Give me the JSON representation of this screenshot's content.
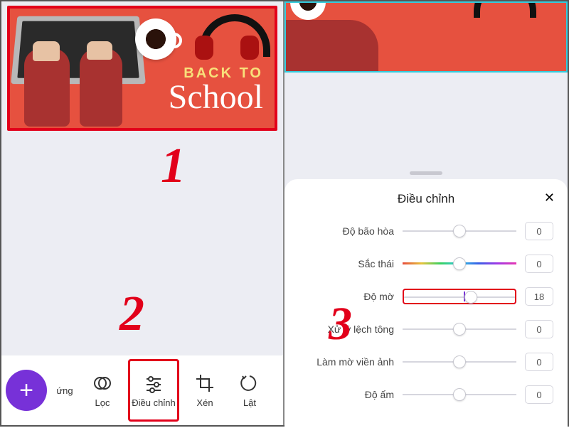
{
  "left": {
    "banner": {
      "line1": "BACK TO",
      "line2": "School"
    },
    "toolbar": {
      "fab": "+",
      "items": [
        {
          "label": "ứng",
          "icon": "sparkle-icon"
        },
        {
          "label": "Lọc",
          "icon": "overlap-circles-icon"
        },
        {
          "label": "Điều chỉnh",
          "icon": "sliders-icon",
          "selected": true
        },
        {
          "label": "Xén",
          "icon": "crop-icon"
        },
        {
          "label": "Lật",
          "icon": "flip-icon"
        }
      ]
    }
  },
  "right": {
    "panel_title": "Điều chỉnh",
    "close": "✕",
    "rows": [
      {
        "label": "Độ bão hòa",
        "value": "0",
        "thumb_pct": 50,
        "rainbow": false
      },
      {
        "label": "Sắc thái",
        "value": "0",
        "thumb_pct": 50,
        "rainbow": true
      },
      {
        "label": "Độ mờ",
        "value": "18",
        "thumb_pct": 60,
        "rainbow": false,
        "highlight": true
      },
      {
        "label": "Xử lý lệch tông",
        "value": "0",
        "thumb_pct": 50,
        "rainbow": false
      },
      {
        "label": "Làm mờ viền ảnh",
        "value": "0",
        "thumb_pct": 50,
        "rainbow": false
      },
      {
        "label": "Độ ấm",
        "value": "0",
        "thumb_pct": 50,
        "rainbow": false
      }
    ]
  },
  "annotations": {
    "a1": "1",
    "a2": "2",
    "a3": "3"
  }
}
